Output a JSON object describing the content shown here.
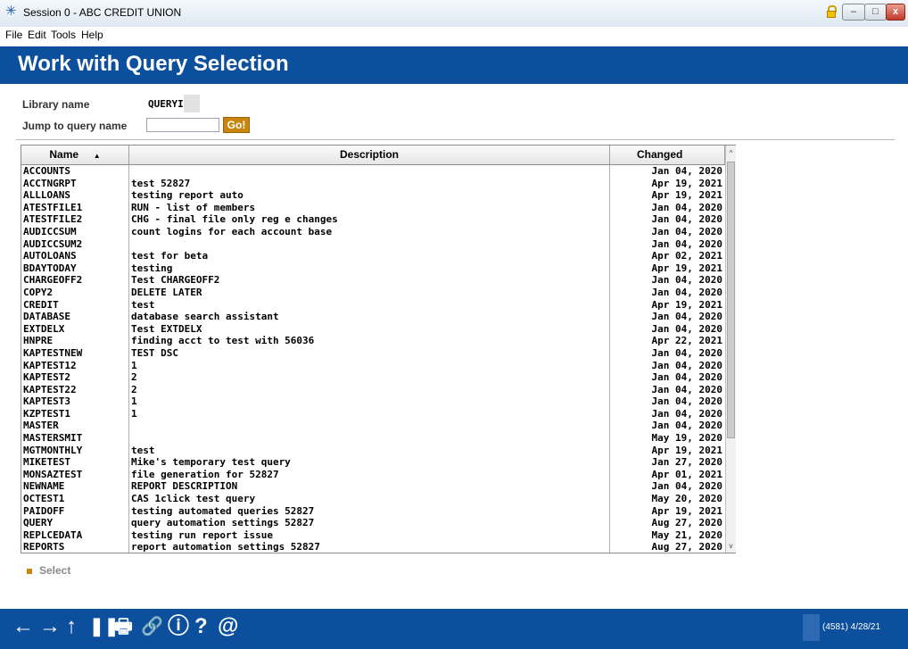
{
  "window": {
    "title": "Session 0 - ABC CREDIT UNION",
    "controls": {
      "minimize": "–",
      "maximize": "□",
      "close": "x"
    }
  },
  "menu": [
    "File",
    "Edit",
    "Tools",
    "Help"
  ],
  "page_title": "Work with Query Selection",
  "form": {
    "library_label": "Library name",
    "library_value": "QUERYI",
    "jump_label": "Jump to query name",
    "jump_value": "",
    "go_label": "Go!"
  },
  "table": {
    "headers": {
      "name": "Name",
      "description": "Description",
      "changed": "Changed"
    },
    "sort_indicator": "▲",
    "rows": [
      {
        "name": "ACCOUNTS",
        "desc": "",
        "changed": "Jan 04, 2020"
      },
      {
        "name": "ACCTNGRPT",
        "desc": "test 52827",
        "changed": "Apr 19, 2021"
      },
      {
        "name": "ALLLOANS",
        "desc": "testing report auto",
        "changed": "Apr 19, 2021"
      },
      {
        "name": "ATESTFILE1",
        "desc": "RUN - list of members",
        "changed": "Jan 04, 2020"
      },
      {
        "name": "ATESTFILE2",
        "desc": "CHG - final file only reg e changes",
        "changed": "Jan 04, 2020"
      },
      {
        "name": "AUDICCSUM",
        "desc": "count logins for each account base",
        "changed": "Jan 04, 2020"
      },
      {
        "name": "AUDICCSUM2",
        "desc": "",
        "changed": "Jan 04, 2020"
      },
      {
        "name": "AUTOLOANS",
        "desc": "test for beta",
        "changed": "Apr 02, 2021"
      },
      {
        "name": "BDAYTODAY",
        "desc": "testing",
        "changed": "Apr 19, 2021"
      },
      {
        "name": "CHARGEOFF2",
        "desc": "Test CHARGEOFF2",
        "changed": "Jan 04, 2020"
      },
      {
        "name": "COPY2",
        "desc": "DELETE LATER",
        "changed": "Jan 04, 2020"
      },
      {
        "name": "CREDIT",
        "desc": "test",
        "changed": "Apr 19, 2021"
      },
      {
        "name": "DATABASE",
        "desc": "database search assistant",
        "changed": "Jan 04, 2020"
      },
      {
        "name": "EXTDELX",
        "desc": "Test EXTDELX",
        "changed": "Jan 04, 2020"
      },
      {
        "name": "HNPRE",
        "desc": "finding acct to test with 56036",
        "changed": "Apr 22, 2021"
      },
      {
        "name": "KAPTESTNEW",
        "desc": "TEST DSC",
        "changed": "Jan 04, 2020"
      },
      {
        "name": "KAPTEST12",
        "desc": "1",
        "changed": "Jan 04, 2020"
      },
      {
        "name": "KAPTEST2",
        "desc": "2",
        "changed": "Jan 04, 2020"
      },
      {
        "name": "KAPTEST22",
        "desc": "2",
        "changed": "Jan 04, 2020"
      },
      {
        "name": "KAPTEST3",
        "desc": "1",
        "changed": "Jan 04, 2020"
      },
      {
        "name": "KZPTEST1",
        "desc": "1",
        "changed": "Jan 04, 2020"
      },
      {
        "name": "MASTER",
        "desc": "",
        "changed": "Jan 04, 2020"
      },
      {
        "name": "MASTERSMIT",
        "desc": "",
        "changed": "May 19, 2020"
      },
      {
        "name": "MGTMONTHLY",
        "desc": "test",
        "changed": "Apr 19, 2021"
      },
      {
        "name": "MIKETEST",
        "desc": "Mike's temporary test query",
        "changed": "Jan 27, 2020"
      },
      {
        "name": "MONSAZTEST",
        "desc": "file generation for 52827",
        "changed": "Apr 01, 2021"
      },
      {
        "name": "NEWNAME",
        "desc": "REPORT DESCRIPTION",
        "changed": "Jan 04, 2020"
      },
      {
        "name": "OCTEST1",
        "desc": "CAS 1click test query",
        "changed": "May 20, 2020"
      },
      {
        "name": "PAIDOFF",
        "desc": "testing automated queries 52827",
        "changed": "Apr 19, 2021"
      },
      {
        "name": "QUERY",
        "desc": "query automation settings 52827",
        "changed": "Aug 27, 2020"
      },
      {
        "name": "REPLCEDATA",
        "desc": "testing run report issue",
        "changed": "May 21, 2020"
      },
      {
        "name": "REPORTS",
        "desc": "report automation settings 52827",
        "changed": "Aug 27, 2020"
      }
    ]
  },
  "actions": {
    "select_label": "Select"
  },
  "footer": {
    "icons": [
      "←",
      "→",
      "↑",
      "❚❚",
      "🖶",
      "🔗",
      "ⓘ",
      "?",
      "@"
    ],
    "status": "(4581) 4/28/21"
  }
}
